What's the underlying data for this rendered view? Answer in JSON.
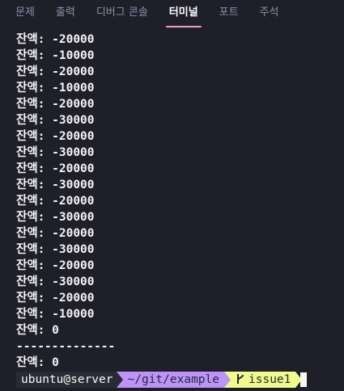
{
  "tabs": [
    {
      "label": "문제",
      "active": false
    },
    {
      "label": "출력",
      "active": false
    },
    {
      "label": "디버그 콘솔",
      "active": false
    },
    {
      "label": "터미널",
      "active": true
    },
    {
      "label": "포트",
      "active": false
    },
    {
      "label": "주석",
      "active": false
    }
  ],
  "terminal": {
    "lines": [
      "잔액: -20000",
      "잔액: -10000",
      "잔액: -20000",
      "잔액: -10000",
      "잔액: -20000",
      "잔액: -30000",
      "잔액: -20000",
      "잔액: -30000",
      "잔액: -20000",
      "잔액: -30000",
      "잔액: -20000",
      "잔액: -30000",
      "잔액: -20000",
      "잔액: -30000",
      "잔액: -20000",
      "잔액: -30000",
      "잔액: -20000",
      "잔액: -10000",
      "잔액: 0",
      "--------------",
      "잔액: 0"
    ]
  },
  "prompt": {
    "user_host": "ubuntu@server",
    "path": "~/git/example",
    "branch": "issue1",
    "branch_icon": "git-branch-icon"
  },
  "colors": {
    "background": "#1e1f29",
    "active_tab_underline": "#e8a2c4",
    "path_segment": "#bd93f9",
    "git_segment": "#f1fa8c"
  }
}
